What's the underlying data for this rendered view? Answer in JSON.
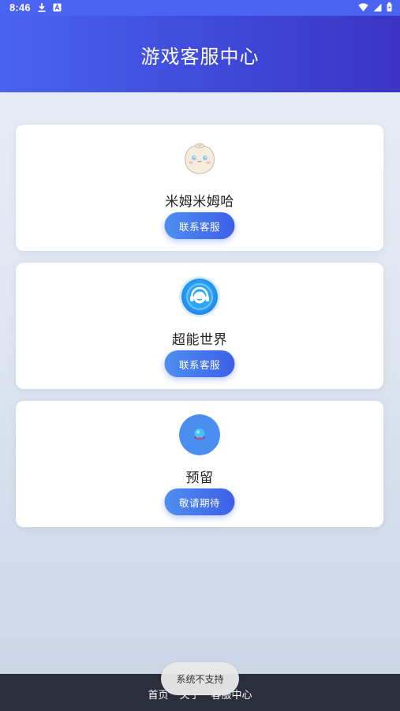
{
  "status_bar": {
    "time": "8:46",
    "icons": [
      "download-icon",
      "text-a-icon",
      "wifi-icon",
      "signal-icon",
      "battery-icon"
    ]
  },
  "header": {
    "title": "游戏客服中心"
  },
  "cards": [
    {
      "title": "米姆米姆哈",
      "button_label": "联系客服",
      "icon": "dumpling-mascot-icon"
    },
    {
      "title": "超能世界",
      "button_label": "联系客服",
      "icon": "headset-support-icon"
    },
    {
      "title": "预留",
      "button_label": "敬请期待",
      "icon": "planet-placeholder-icon"
    }
  ],
  "bottom_nav": {
    "items": [
      "首页",
      "关于",
      "客服中心"
    ]
  },
  "toast": {
    "text": "系统不支持"
  },
  "colors": {
    "header_gradient_start": "#4a63f0",
    "header_gradient_end": "#3b34c6",
    "button_gradient_start": "#4e8ff0",
    "button_gradient_end": "#3d5fe8",
    "bottom_nav_bg": "#2b2e3d"
  }
}
